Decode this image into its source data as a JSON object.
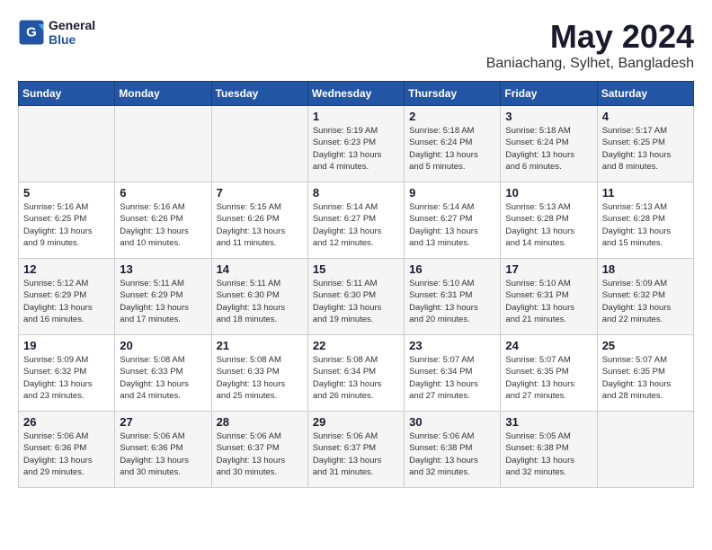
{
  "header": {
    "logo_text_general": "General",
    "logo_text_blue": "Blue",
    "month": "May 2024",
    "location": "Baniachang, Sylhet, Bangladesh"
  },
  "weekdays": [
    "Sunday",
    "Monday",
    "Tuesday",
    "Wednesday",
    "Thursday",
    "Friday",
    "Saturday"
  ],
  "weeks": [
    [
      {
        "day": "",
        "info": ""
      },
      {
        "day": "",
        "info": ""
      },
      {
        "day": "",
        "info": ""
      },
      {
        "day": "1",
        "info": "Sunrise: 5:19 AM\nSunset: 6:23 PM\nDaylight: 13 hours\nand 4 minutes."
      },
      {
        "day": "2",
        "info": "Sunrise: 5:18 AM\nSunset: 6:24 PM\nDaylight: 13 hours\nand 5 minutes."
      },
      {
        "day": "3",
        "info": "Sunrise: 5:18 AM\nSunset: 6:24 PM\nDaylight: 13 hours\nand 6 minutes."
      },
      {
        "day": "4",
        "info": "Sunrise: 5:17 AM\nSunset: 6:25 PM\nDaylight: 13 hours\nand 8 minutes."
      }
    ],
    [
      {
        "day": "5",
        "info": "Sunrise: 5:16 AM\nSunset: 6:25 PM\nDaylight: 13 hours\nand 9 minutes."
      },
      {
        "day": "6",
        "info": "Sunrise: 5:16 AM\nSunset: 6:26 PM\nDaylight: 13 hours\nand 10 minutes."
      },
      {
        "day": "7",
        "info": "Sunrise: 5:15 AM\nSunset: 6:26 PM\nDaylight: 13 hours\nand 11 minutes."
      },
      {
        "day": "8",
        "info": "Sunrise: 5:14 AM\nSunset: 6:27 PM\nDaylight: 13 hours\nand 12 minutes."
      },
      {
        "day": "9",
        "info": "Sunrise: 5:14 AM\nSunset: 6:27 PM\nDaylight: 13 hours\nand 13 minutes."
      },
      {
        "day": "10",
        "info": "Sunrise: 5:13 AM\nSunset: 6:28 PM\nDaylight: 13 hours\nand 14 minutes."
      },
      {
        "day": "11",
        "info": "Sunrise: 5:13 AM\nSunset: 6:28 PM\nDaylight: 13 hours\nand 15 minutes."
      }
    ],
    [
      {
        "day": "12",
        "info": "Sunrise: 5:12 AM\nSunset: 6:29 PM\nDaylight: 13 hours\nand 16 minutes."
      },
      {
        "day": "13",
        "info": "Sunrise: 5:11 AM\nSunset: 6:29 PM\nDaylight: 13 hours\nand 17 minutes."
      },
      {
        "day": "14",
        "info": "Sunrise: 5:11 AM\nSunset: 6:30 PM\nDaylight: 13 hours\nand 18 minutes."
      },
      {
        "day": "15",
        "info": "Sunrise: 5:11 AM\nSunset: 6:30 PM\nDaylight: 13 hours\nand 19 minutes."
      },
      {
        "day": "16",
        "info": "Sunrise: 5:10 AM\nSunset: 6:31 PM\nDaylight: 13 hours\nand 20 minutes."
      },
      {
        "day": "17",
        "info": "Sunrise: 5:10 AM\nSunset: 6:31 PM\nDaylight: 13 hours\nand 21 minutes."
      },
      {
        "day": "18",
        "info": "Sunrise: 5:09 AM\nSunset: 6:32 PM\nDaylight: 13 hours\nand 22 minutes."
      }
    ],
    [
      {
        "day": "19",
        "info": "Sunrise: 5:09 AM\nSunset: 6:32 PM\nDaylight: 13 hours\nand 23 minutes."
      },
      {
        "day": "20",
        "info": "Sunrise: 5:08 AM\nSunset: 6:33 PM\nDaylight: 13 hours\nand 24 minutes."
      },
      {
        "day": "21",
        "info": "Sunrise: 5:08 AM\nSunset: 6:33 PM\nDaylight: 13 hours\nand 25 minutes."
      },
      {
        "day": "22",
        "info": "Sunrise: 5:08 AM\nSunset: 6:34 PM\nDaylight: 13 hours\nand 26 minutes."
      },
      {
        "day": "23",
        "info": "Sunrise: 5:07 AM\nSunset: 6:34 PM\nDaylight: 13 hours\nand 27 minutes."
      },
      {
        "day": "24",
        "info": "Sunrise: 5:07 AM\nSunset: 6:35 PM\nDaylight: 13 hours\nand 27 minutes."
      },
      {
        "day": "25",
        "info": "Sunrise: 5:07 AM\nSunset: 6:35 PM\nDaylight: 13 hours\nand 28 minutes."
      }
    ],
    [
      {
        "day": "26",
        "info": "Sunrise: 5:06 AM\nSunset: 6:36 PM\nDaylight: 13 hours\nand 29 minutes."
      },
      {
        "day": "27",
        "info": "Sunrise: 5:06 AM\nSunset: 6:36 PM\nDaylight: 13 hours\nand 30 minutes."
      },
      {
        "day": "28",
        "info": "Sunrise: 5:06 AM\nSunset: 6:37 PM\nDaylight: 13 hours\nand 30 minutes."
      },
      {
        "day": "29",
        "info": "Sunrise: 5:06 AM\nSunset: 6:37 PM\nDaylight: 13 hours\nand 31 minutes."
      },
      {
        "day": "30",
        "info": "Sunrise: 5:06 AM\nSunset: 6:38 PM\nDaylight: 13 hours\nand 32 minutes."
      },
      {
        "day": "31",
        "info": "Sunrise: 5:05 AM\nSunset: 6:38 PM\nDaylight: 13 hours\nand 32 minutes."
      },
      {
        "day": "",
        "info": ""
      }
    ]
  ]
}
